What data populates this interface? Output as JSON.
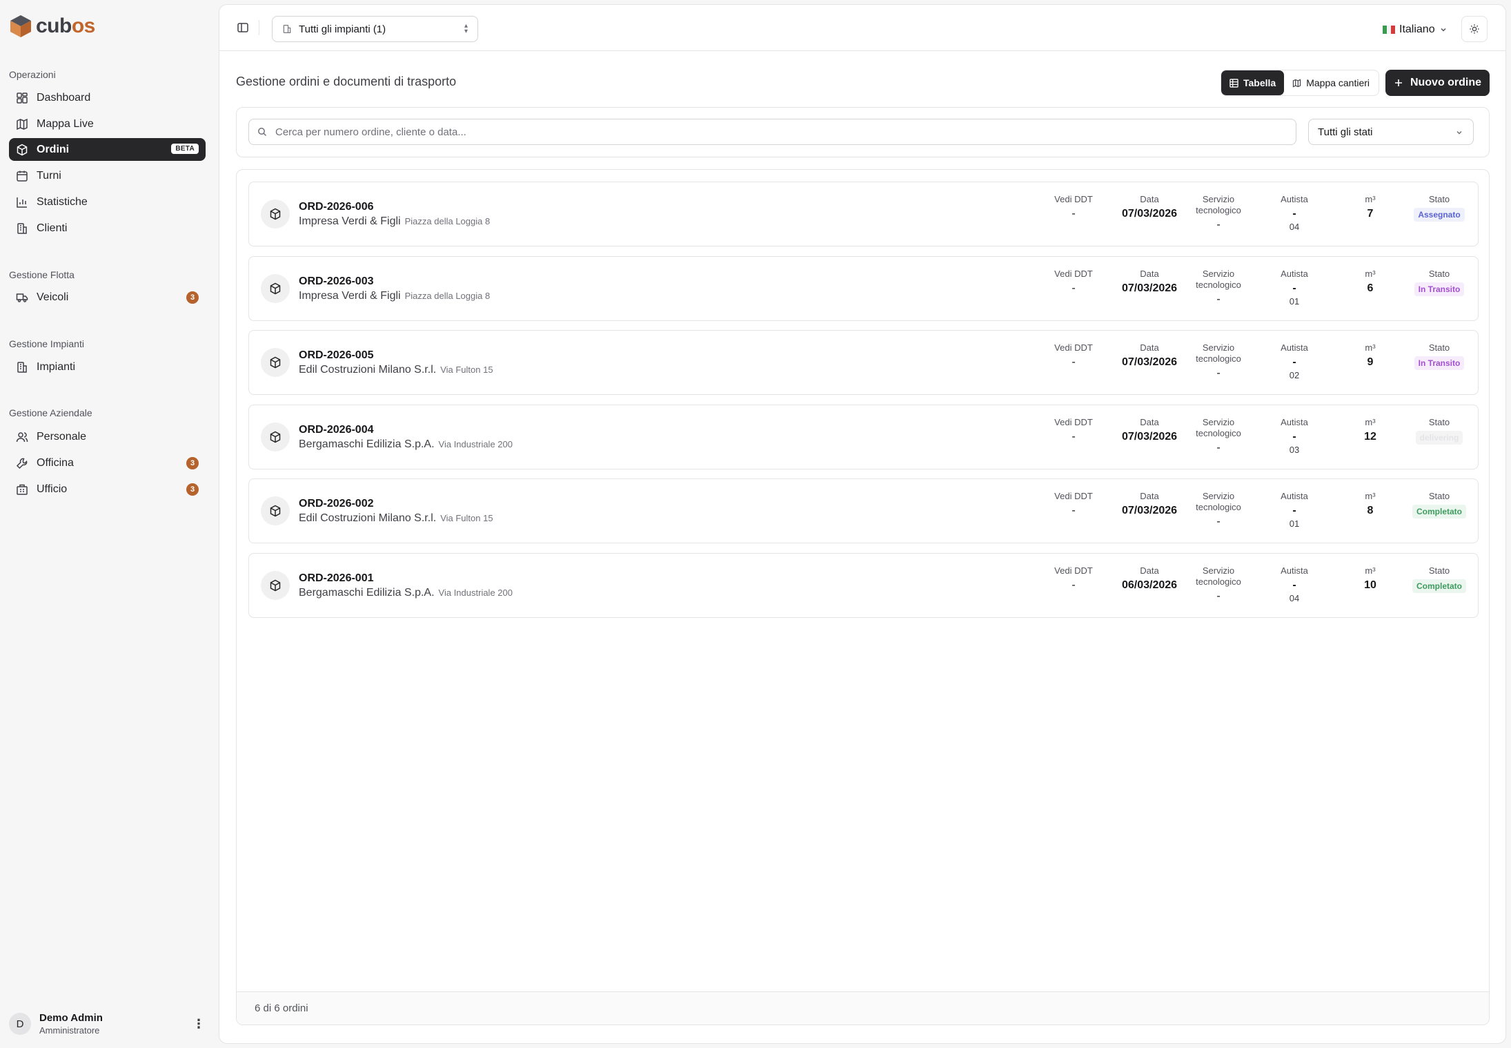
{
  "brand": {
    "logo_text_main": "cub",
    "logo_text_accent": "os"
  },
  "sidebar": {
    "sections": [
      {
        "title": "Operazioni"
      },
      {
        "title": "Gestione Flotta"
      },
      {
        "title": "Gestione Impianti"
      },
      {
        "title": "Gestione Aziendale"
      }
    ],
    "items": [
      {
        "label": "Dashboard"
      },
      {
        "label": "Mappa Live"
      },
      {
        "label": "Ordini",
        "badge": "BETA"
      },
      {
        "label": "Turni"
      },
      {
        "label": "Statistiche"
      },
      {
        "label": "Clienti"
      },
      {
        "label": "Veicoli",
        "count": "3"
      },
      {
        "label": "Impianti"
      },
      {
        "label": "Personale"
      },
      {
        "label": "Officina",
        "count": "3"
      },
      {
        "label": "Ufficio",
        "count": "3"
      }
    ],
    "user": {
      "initial": "D",
      "name": "Demo Admin",
      "role": "Amministratore"
    }
  },
  "topbar": {
    "plant_select": "Tutti gli impianti (1)",
    "language": "Italiano"
  },
  "header": {
    "subtitle": "Gestione ordini e documenti di trasporto",
    "view_table": "Tabella",
    "view_map": "Mappa cantieri",
    "new_order": "Nuovo ordine"
  },
  "filters": {
    "search_placeholder": "Cerca per numero ordine, cliente o data...",
    "status_select": "Tutti gli stati"
  },
  "columns": {
    "ddt": "Vedi DDT",
    "date": "Data",
    "service_line1": "Servizio",
    "service_line2": "tecnologico",
    "driver": "Autista",
    "volume": "m³",
    "status": "Stato"
  },
  "orders": [
    {
      "id": "ORD-2026-006",
      "client": "Impresa Verdi & Figli",
      "address": "Piazza della Loggia 8",
      "ddt": "-",
      "date": "07/03/2026",
      "service": "-",
      "driver": "-",
      "driver_code": "04",
      "volume": "7",
      "status": "Assegnato",
      "status_color": "#5b63d3",
      "status_bg": "#eef0fc"
    },
    {
      "id": "ORD-2026-003",
      "client": "Impresa Verdi & Figli",
      "address": "Piazza della Loggia 8",
      "ddt": "-",
      "date": "07/03/2026",
      "service": "-",
      "driver": "-",
      "driver_code": "01",
      "volume": "6",
      "status": "In Transito",
      "status_color": "#a34fd0",
      "status_bg": "#f6ecfb"
    },
    {
      "id": "ORD-2026-005",
      "client": "Edil Costruzioni Milano S.r.l.",
      "address": "Via Fulton 15",
      "ddt": "-",
      "date": "07/03/2026",
      "service": "-",
      "driver": "-",
      "driver_code": "02",
      "volume": "9",
      "status": "In Transito",
      "status_color": "#a34fd0",
      "status_bg": "#f6ecfb"
    },
    {
      "id": "ORD-2026-004",
      "client": "Bergamaschi Edilizia S.p.A.",
      "address": "Via Industriale 200",
      "ddt": "-",
      "date": "07/03/2026",
      "service": "-",
      "driver": "-",
      "driver_code": "03",
      "volume": "12",
      "status": "delivering",
      "status_color": "#e4e4e7",
      "status_bg": "#f4f4f5"
    },
    {
      "id": "ORD-2026-002",
      "client": "Edil Costruzioni Milano S.r.l.",
      "address": "Via Fulton 15",
      "ddt": "-",
      "date": "07/03/2026",
      "service": "-",
      "driver": "-",
      "driver_code": "01",
      "volume": "8",
      "status": "Completato",
      "status_color": "#3f9b5f",
      "status_bg": "#eaf6ee"
    },
    {
      "id": "ORD-2026-001",
      "client": "Bergamaschi Edilizia S.p.A.",
      "address": "Via Industriale 200",
      "ddt": "-",
      "date": "06/03/2026",
      "service": "-",
      "driver": "-",
      "driver_code": "04",
      "volume": "10",
      "status": "Completato",
      "status_color": "#3f9b5f",
      "status_bg": "#eaf6ee"
    }
  ],
  "footer": {
    "count_text": "6 di 6 ordini"
  },
  "colors": {
    "accent": "#27272a",
    "badge": "#b5622d",
    "brand_orange": "#c2652a"
  }
}
